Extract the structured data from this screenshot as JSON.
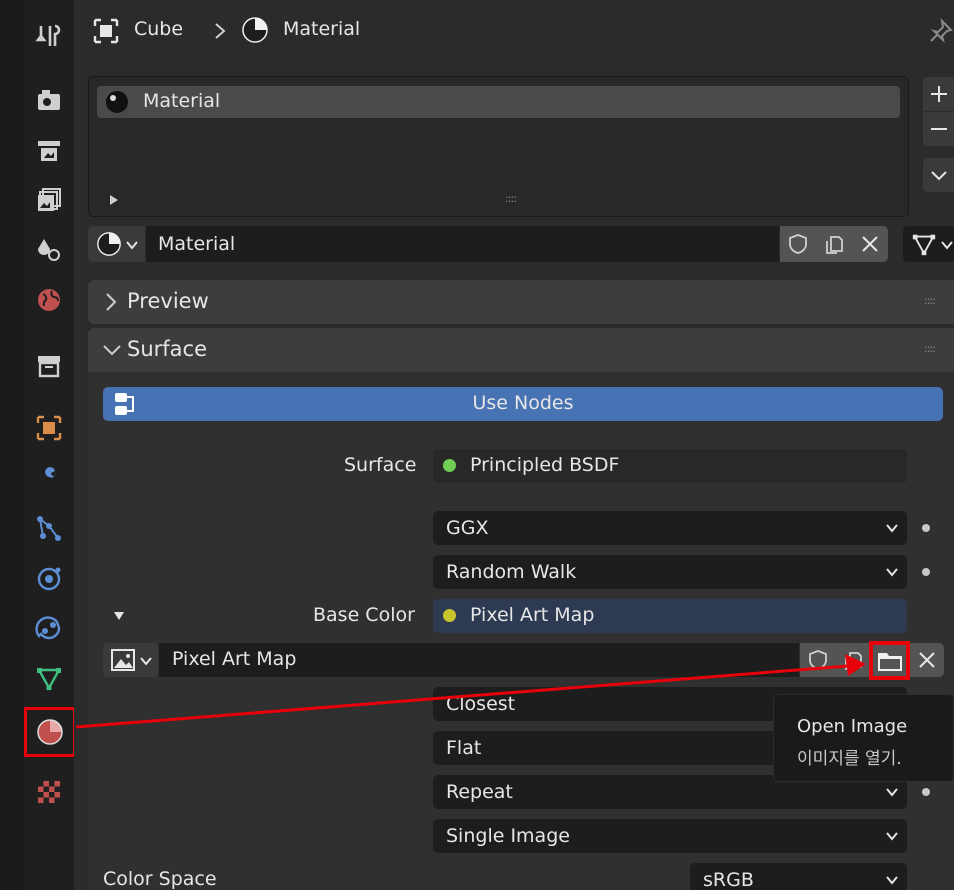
{
  "breadcrumb": {
    "object": "Cube",
    "material": "Material"
  },
  "material_slots": {
    "items": [
      "Material"
    ],
    "grip": "::::"
  },
  "datablock": {
    "name": "Material"
  },
  "panels": {
    "preview": "Preview",
    "surface": "Surface"
  },
  "use_nodes": "Use Nodes",
  "surface_label": "Surface",
  "surface_shader": "Principled BSDF",
  "distribution": "GGX",
  "subsurface_method": "Random Walk",
  "base_color": {
    "label": "Base Color",
    "value": "Pixel Art Map"
  },
  "image": {
    "name": "Pixel Art Map"
  },
  "interpolation": "Closest",
  "projection": "Flat",
  "extension": "Repeat",
  "source": "Single Image",
  "color_space": {
    "label": "Color Space",
    "value": "sRGB"
  },
  "tooltip": {
    "title": "Open Image",
    "subtitle": "이미지를 열기."
  },
  "colors": {
    "accent_blue": "#4772b3",
    "highlight_red": "#e8000b",
    "shader_green": "#6fcf55",
    "color_yellow": "#c8c42e"
  },
  "icons": [
    "tool-icon",
    "render-icon",
    "output-icon",
    "view-layer-icon",
    "scene-icon",
    "world-icon",
    "collection-icon",
    "object-icon",
    "modifier-icon",
    "particles-icon",
    "physics-icon",
    "constraints-icon",
    "data-icon",
    "material-icon",
    "texture-icon",
    "pin-icon",
    "folder-icon"
  ]
}
